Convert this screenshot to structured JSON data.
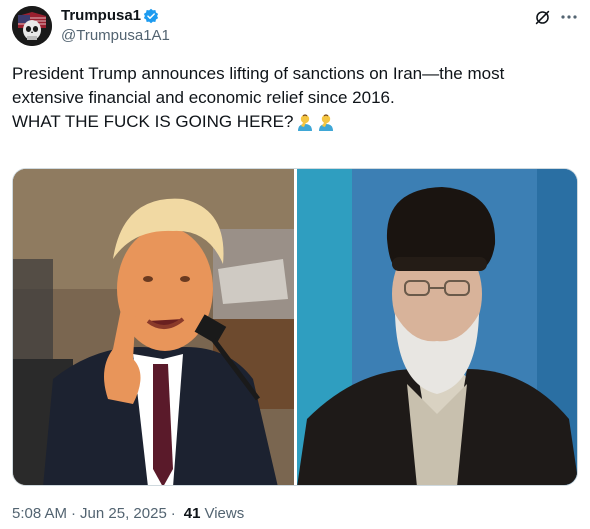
{
  "author": {
    "display_name": "Trumpusa1",
    "handle": "@Trumpusa1A1",
    "avatar_icon": "skull-flag-avatar",
    "verified_icon": "verified-badge-icon",
    "verified_color": "#1d9bf0"
  },
  "header_actions": {
    "grok_icon": "grok-icon",
    "more_icon": "more-icon"
  },
  "tweet": {
    "line1": "President Trump announces lifting of sanctions on Iran—the most",
    "line2": "extensive financial and economic relief since 2016.",
    "line3": "WHAT THE FUCK IS GOING HERE?",
    "emoji_icon": "man-facepalming-icon"
  },
  "media": {
    "left_photo": "photo-trump-speaking",
    "right_photo": "photo-khamenei-portrait"
  },
  "meta": {
    "time": "5:08 AM",
    "separator": "·",
    "date": "Jun 25, 2025",
    "separator2": "·",
    "views_count": "41",
    "views_label": "Views"
  },
  "colors": {
    "text_primary": "#0f1419",
    "text_secondary": "#536471",
    "border": "#cfd9de"
  }
}
